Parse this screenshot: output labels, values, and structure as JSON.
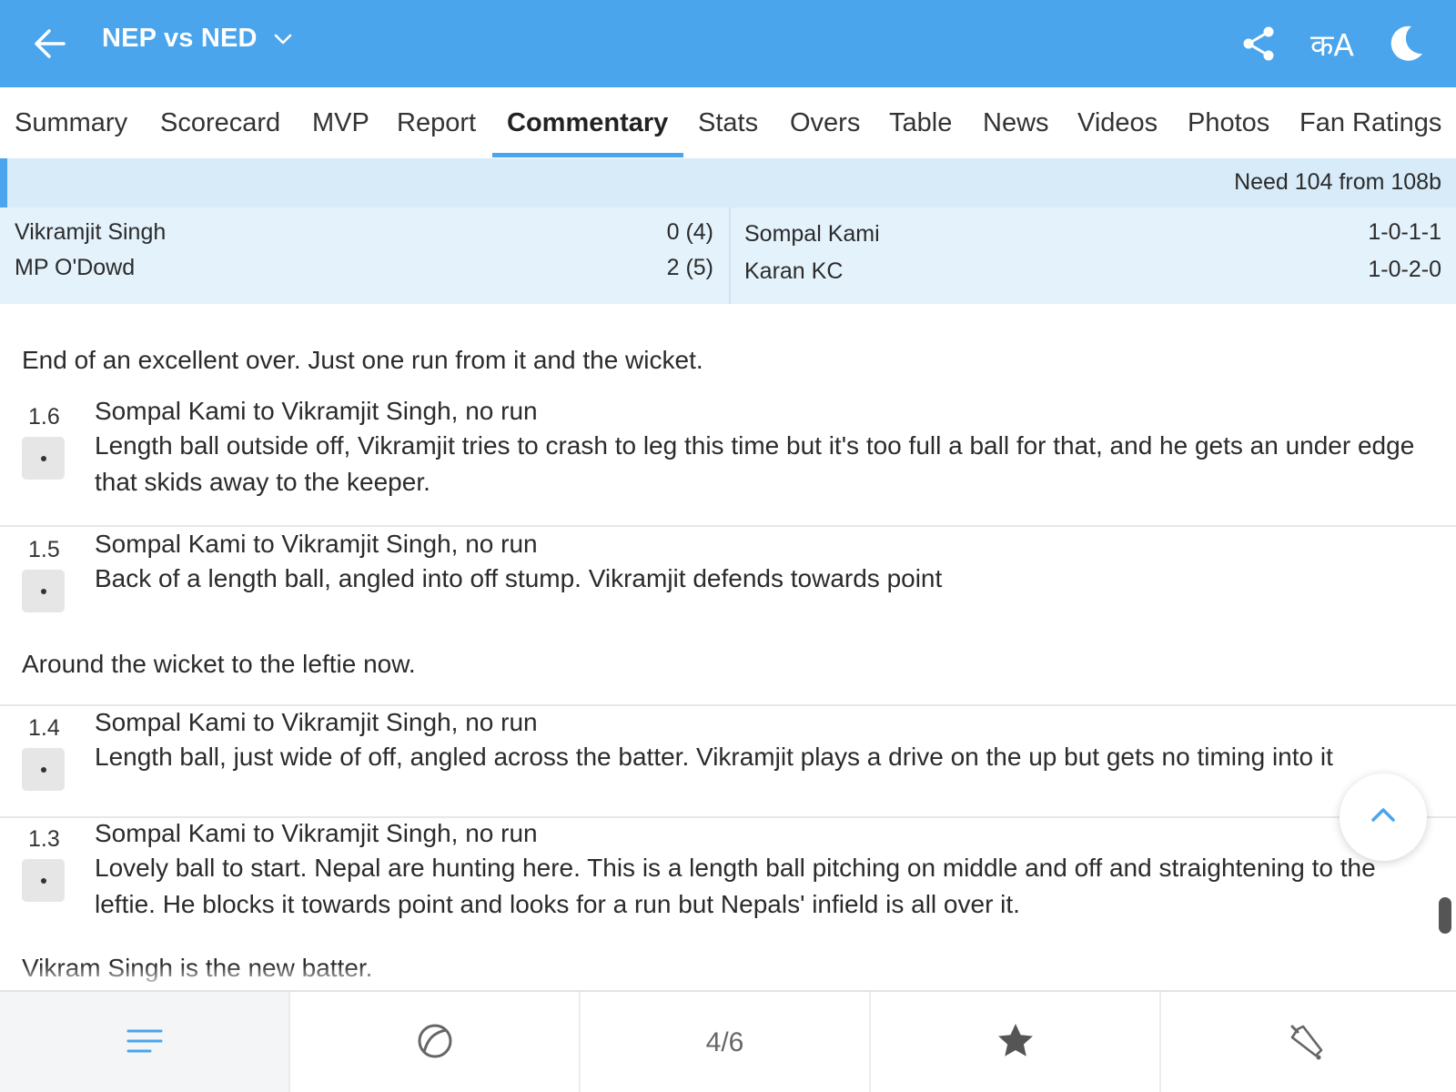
{
  "header": {
    "title": "NEP vs NED",
    "back_icon": "arrow-left-icon",
    "share_icon": "share-icon",
    "language_label": "कA",
    "theme_icon": "moon-icon",
    "bg_color": "#4aa5ec"
  },
  "tabs": [
    {
      "label": "Summary"
    },
    {
      "label": "Scorecard"
    },
    {
      "label": "MVP"
    },
    {
      "label": "Report"
    },
    {
      "label": "Commentary",
      "active": true
    },
    {
      "label": "Stats"
    },
    {
      "label": "Overs"
    },
    {
      "label": "Table"
    },
    {
      "label": "News"
    },
    {
      "label": "Videos"
    },
    {
      "label": "Photos"
    },
    {
      "label": "Fan Ratings"
    }
  ],
  "score": {
    "need_text": "Need 104 from 108b",
    "batters": [
      {
        "name": "Vikramjit Singh",
        "score": "0 (4)"
      },
      {
        "name": "MP O'Dowd",
        "score": "2 (5)"
      }
    ],
    "bowlers": [
      {
        "name": "Sompal Kami",
        "figures": "1-0-1-1"
      },
      {
        "name": "Karan KC",
        "figures": "1-0-2-0"
      }
    ]
  },
  "commentary": {
    "over_end_note": "End of an excellent over. Just one run from it and the wicket.",
    "balls": [
      {
        "over": "1.6",
        "headline": "Sompal Kami to Vikramjit Singh, no run",
        "text": "Length ball outside off, Vikramjit tries to crash to leg this time but it's too full a ball for that, and he gets an under edge that skids away to the keeper."
      },
      {
        "over": "1.5",
        "headline": "Sompal Kami to Vikramjit Singh, no run",
        "text": "Back of a length ball, angled into off stump. Vikramjit defends towards point"
      },
      {
        "over": "1.4",
        "headline": "Sompal Kami to Vikramjit Singh, no run",
        "text": "Length ball, just wide of off, angled across the batter. Vikramjit plays a drive on the up but gets no timing into it"
      },
      {
        "over": "1.3",
        "headline": "Sompal Kami to Vikramjit Singh, no run",
        "text": "Lovely ball to start. Nepal are hunting here. This is a length ball pitching on middle and off and straightening to the leftie. He blocks it towards point and looks for a run but Nepals' infield is all over it."
      }
    ],
    "mid_note": "Around the wicket to the leftie now.",
    "bottom_note": "Vikram Singh is the new batter."
  },
  "scroll_top_icon": "chevron-up-icon",
  "bottom_nav": {
    "items": [
      {
        "icon": "menu-lines-icon"
      },
      {
        "icon": "cricket-ball-icon"
      },
      {
        "label": "4/6"
      },
      {
        "icon": "star-icon"
      },
      {
        "icon": "cricket-bat-icon"
      }
    ]
  }
}
